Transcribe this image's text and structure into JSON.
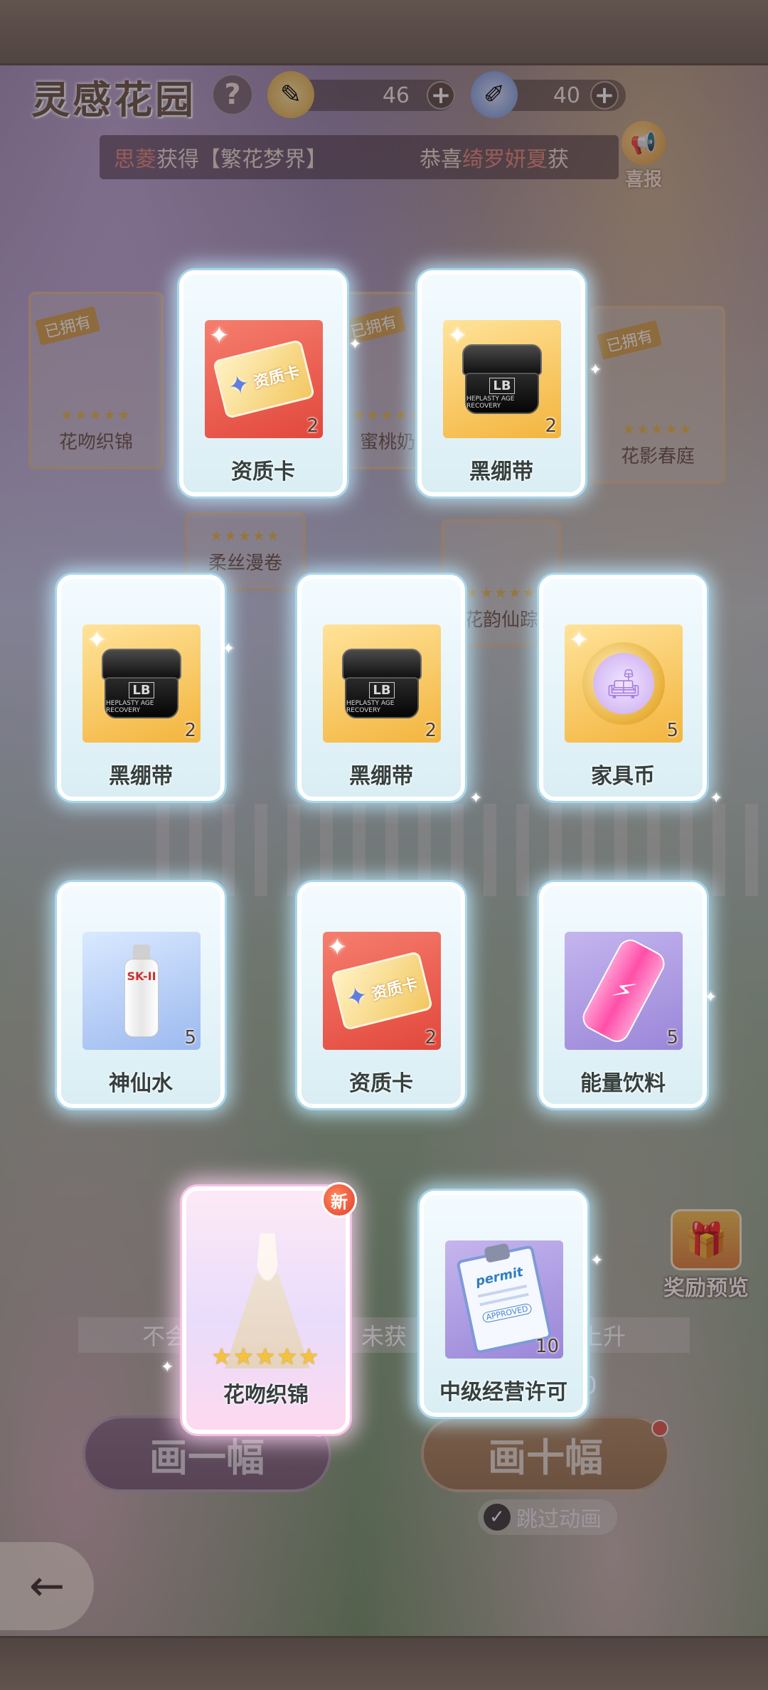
{
  "header": {
    "title": "灵感花园",
    "help_label": "?",
    "resource_1": {
      "icon": "paintbrush-icon",
      "value": "46",
      "plus": "+"
    },
    "resource_2": {
      "icon": "paint-tube-icon",
      "value": "40",
      "plus": "+"
    }
  },
  "ticker": {
    "msg1_name": "思菱",
    "msg1_text": "获得【繁花梦界】",
    "msg2_prefix": "恭喜",
    "msg2_name": "绮罗妍夏",
    "msg2_text": "获"
  },
  "news_button": {
    "label": "喜报",
    "icon": "megaphone-icon"
  },
  "background_cards": [
    {
      "owned": "已拥有",
      "stars": "★★★★★",
      "name": "花吻织锦"
    },
    {
      "owned": "已拥有",
      "stars": "★★★★★",
      "name": "蜜桃奶"
    },
    {
      "owned": "已拥有",
      "stars": "★★★★★",
      "name": "花影春庭"
    },
    {
      "stars": "★★★★★",
      "name": "柔丝漫卷"
    },
    {
      "stars": "★★★★★",
      "name": "花韵仙踪"
    }
  ],
  "rewards": [
    {
      "name": "资质卡",
      "qty": "2",
      "icon": "qualification-card-icon",
      "ticket_text": "资质卡"
    },
    {
      "name": "黑绷带",
      "qty": "2",
      "icon": "black-jar-icon",
      "jar_brand": "LB",
      "jar_text": "HEPLASTY AGE RECOVERY"
    },
    {
      "name": "黑绷带",
      "qty": "2",
      "icon": "black-jar-icon",
      "jar_brand": "LB",
      "jar_text": "HEPLASTY AGE RECOVERY"
    },
    {
      "name": "黑绷带",
      "qty": "2",
      "icon": "black-jar-icon",
      "jar_brand": "LB",
      "jar_text": "HEPLASTY AGE RECOVERY"
    },
    {
      "name": "家具币",
      "qty": "5",
      "icon": "furniture-coin-icon"
    },
    {
      "name": "神仙水",
      "qty": "5",
      "icon": "essence-bottle-icon",
      "bottle_text": "SK-II"
    },
    {
      "name": "资质卡",
      "qty": "2",
      "icon": "qualification-card-icon",
      "ticket_text": "资质卡"
    },
    {
      "name": "能量饮料",
      "qty": "5",
      "icon": "energy-drink-icon"
    },
    {
      "name": "花吻织锦",
      "stars": "★★★★★",
      "badge": "新",
      "icon": "gown-icon"
    },
    {
      "name": "中级经营许可",
      "qty": "10",
      "icon": "permit-clipboard-icon",
      "permit_text": "permit",
      "stamp_text": "APPROVED"
    }
  ],
  "hint": {
    "left": "不会",
    "mid": "未获",
    "right": "上升"
  },
  "draw_one_label": "画一幅",
  "draw_ten_label": "画十幅",
  "draw_ten_cost": "0",
  "skip_animation": {
    "label": "跳过动画",
    "checked": true
  },
  "reward_preview": {
    "label": "奖励预览",
    "icon": "gift-box-icon"
  },
  "back_icon": "back-arrow-icon",
  "colors": {
    "card_border": "#a9d5ea",
    "star": "#f5c33b",
    "badge_red": "#e23d2f"
  }
}
